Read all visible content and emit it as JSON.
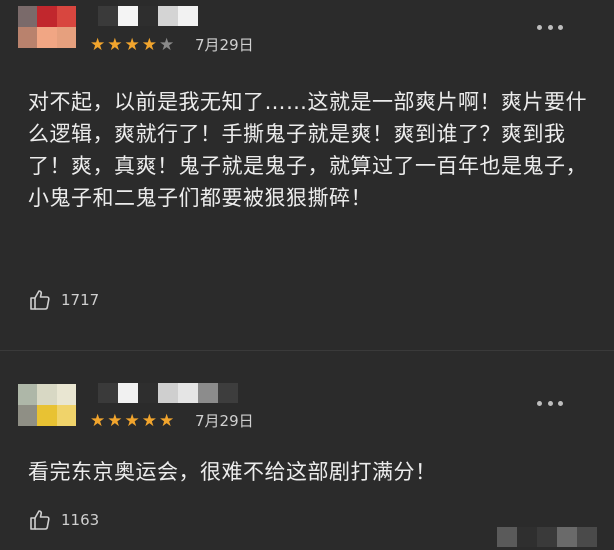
{
  "reviews": [
    {
      "rating": 4,
      "rating_max": 5,
      "date": "7月29日",
      "text": "对不起，以前是我无知了……这就是一部爽片啊！爽片要什么逻辑，爽就行了！手撕鬼子就是爽！爽到谁了？爽到我了！爽，真爽！鬼子就是鬼子，就算过了一百年也是鬼子，小鬼子和二鬼子们都要被狠狠撕碎！",
      "likes": "1717",
      "avatar_colors": [
        "#7a6a6a",
        "#c1272d",
        "#d8463f",
        "#b9826d",
        "#f1a684",
        "#e6a07e"
      ]
    },
    {
      "rating": 5,
      "rating_max": 5,
      "date": "7月29日",
      "text": "看完东京奥运会，很难不给这部剧打满分！",
      "likes": "1163",
      "avatar_colors": [
        "#aeb7a8",
        "#d8d8c4",
        "#e9e6d2",
        "#8f8f85",
        "#e8c233",
        "#f0d36a"
      ]
    }
  ],
  "icons": {
    "more": "more-dots-icon",
    "like": "thumbs-up-icon",
    "star": "star-icon"
  },
  "colors": {
    "background": "#2b2b2b",
    "star": "#f2a52d",
    "text": "#ececec"
  }
}
